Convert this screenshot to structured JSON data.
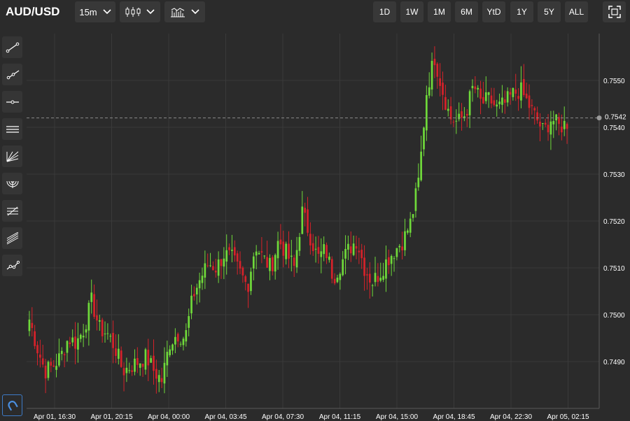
{
  "header": {
    "symbol": "AUD/USD",
    "interval": "15m",
    "chart_type_icon": "candlestick-icon",
    "indicators_icon": "indicators-icon",
    "range_buttons": [
      "1D",
      "1W",
      "1M",
      "6M",
      "YtD",
      "1Y",
      "5Y",
      "ALL"
    ],
    "fullscreen_icon": "fullscreen-icon"
  },
  "toolbar": {
    "tools": [
      {
        "name": "trend-line-icon"
      },
      {
        "name": "ray-icon"
      },
      {
        "name": "horizontal-line-icon"
      },
      {
        "name": "parallel-channel-icon"
      },
      {
        "name": "fib-fan-icon"
      },
      {
        "name": "fib-arc-icon"
      },
      {
        "name": "fib-retracement-icon"
      },
      {
        "name": "pitchfork-icon"
      },
      {
        "name": "path-icon"
      }
    ],
    "magnet_icon": "magnet-icon"
  },
  "colors": {
    "background": "#2b2b2b",
    "grid": "#3a3a3a",
    "up": "#6fd93a",
    "down": "#d6222a",
    "text": "#ffffff",
    "crosshair": "#8a8a8a"
  },
  "chart_data": {
    "type": "candlestick",
    "ylim": [
      0.748,
      0.756
    ],
    "yticks": [
      "0.7490",
      "0.7500",
      "0.7510",
      "0.7520",
      "0.7530",
      "0.7540",
      "0.7550"
    ],
    "yticks_values": [
      0.749,
      0.75,
      0.751,
      0.752,
      0.753,
      0.754,
      0.755
    ],
    "xticks": [
      "Apr 01, 16:30",
      "Apr 01, 20:15",
      "Apr 04, 00:00",
      "Apr 04, 03:45",
      "Apr 04, 07:30",
      "Apr 04, 11:15",
      "Apr 04, 15:00",
      "Apr 04, 18:45",
      "Apr 04, 22:30",
      "Apr 05, 02:15"
    ],
    "last_price": "0.7542",
    "last_price_value": 0.7542,
    "grid": true,
    "close_path": [
      0.7499,
      0.7493,
      0.7488,
      0.7489,
      0.7491,
      0.7495,
      0.7494,
      0.7497,
      0.7503,
      0.7497,
      0.7496,
      0.7493,
      0.7488,
      0.7489,
      0.749,
      0.7491,
      0.7488,
      0.7486,
      0.7494,
      0.7496,
      0.7495,
      0.7504,
      0.7508,
      0.7511,
      0.751,
      0.7513,
      0.7512,
      0.7509,
      0.7506,
      0.7515,
      0.7512,
      0.751,
      0.7516,
      0.7513,
      0.751,
      0.7522,
      0.7517,
      0.7512,
      0.7514,
      0.7508,
      0.7511,
      0.7514,
      0.7516,
      0.751,
      0.7507,
      0.7509,
      0.7512,
      0.7514,
      0.7516,
      0.752,
      0.7529,
      0.7548,
      0.7555,
      0.7548,
      0.7542,
      0.7541,
      0.7543,
      0.7549,
      0.7545,
      0.7546,
      0.7544,
      0.7545,
      0.7547,
      0.7548,
      0.7545,
      0.7542,
      0.7539,
      0.7542,
      0.754,
      0.7541
    ]
  }
}
